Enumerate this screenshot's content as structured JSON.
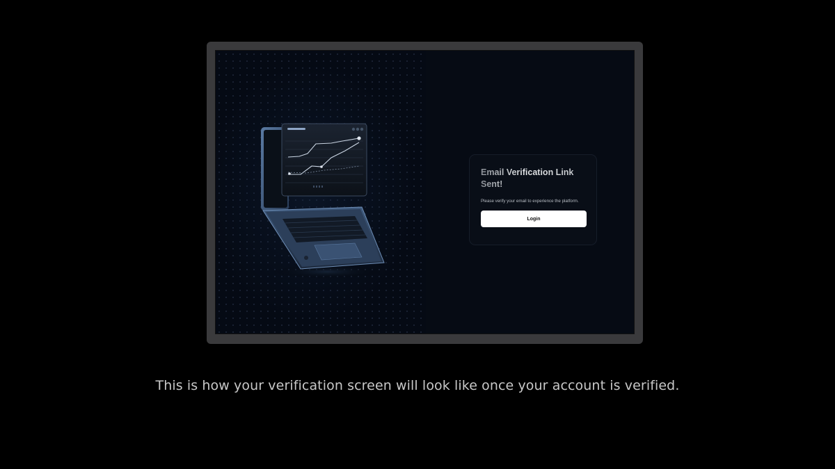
{
  "preview": {
    "card": {
      "title": "Email Verification Link Sent!",
      "message": "Please verify your email to experience the platform.",
      "login_label": "Login"
    },
    "illustration": "laptop-chart-icon"
  },
  "caption": "This is how your verification screen will look like once your account is verified.",
  "colors": {
    "page_background": "#000000",
    "frame": "#3a3a3c",
    "screen_background": "#060b14",
    "card_background": "#090e17",
    "button_background": "#ffffff",
    "caption_text": "#c8c8c8"
  }
}
